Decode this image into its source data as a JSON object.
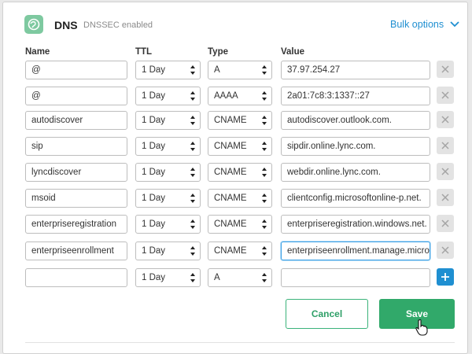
{
  "header": {
    "title": "DNS",
    "subtitle": "DNSSEC enabled",
    "bulk_options": "Bulk options",
    "logo_icon": "leaf-globe-icon",
    "chevron_icon": "chevron-down-icon"
  },
  "columns": {
    "name": "Name",
    "ttl": "TTL",
    "type": "Type",
    "value": "Value"
  },
  "records": [
    {
      "name": "@",
      "ttl": "1 Day",
      "type": "A",
      "value": "37.97.254.27"
    },
    {
      "name": "@",
      "ttl": "1 Day",
      "type": "AAAA",
      "value": "2a01:7c8:3:1337::27"
    },
    {
      "name": "autodiscover",
      "ttl": "1 Day",
      "type": "CNAME",
      "value": "autodiscover.outlook.com."
    },
    {
      "name": "sip",
      "ttl": "1 Day",
      "type": "CNAME",
      "value": "sipdir.online.lync.com."
    },
    {
      "name": "lyncdiscover",
      "ttl": "1 Day",
      "type": "CNAME",
      "value": "webdir.online.lync.com."
    },
    {
      "name": "msoid",
      "ttl": "1 Day",
      "type": "CNAME",
      "value": "clientconfig.microsoftonline-p.net."
    },
    {
      "name": "enterpriseregistration",
      "ttl": "1 Day",
      "type": "CNAME",
      "value": "enterpriseregistration.windows.net."
    },
    {
      "name": "enterpriseenrollment",
      "ttl": "1 Day",
      "type": "CNAME",
      "value": "enterpriseenrollment.manage.micros"
    }
  ],
  "new_record": {
    "name": "",
    "ttl": "1 Day",
    "type": "A",
    "value": ""
  },
  "actions": {
    "cancel": "Cancel",
    "save": "Save"
  },
  "colors": {
    "accent_blue": "#1f8fd1",
    "save_green": "#31a96a",
    "cancel_border": "#3bb37a"
  }
}
